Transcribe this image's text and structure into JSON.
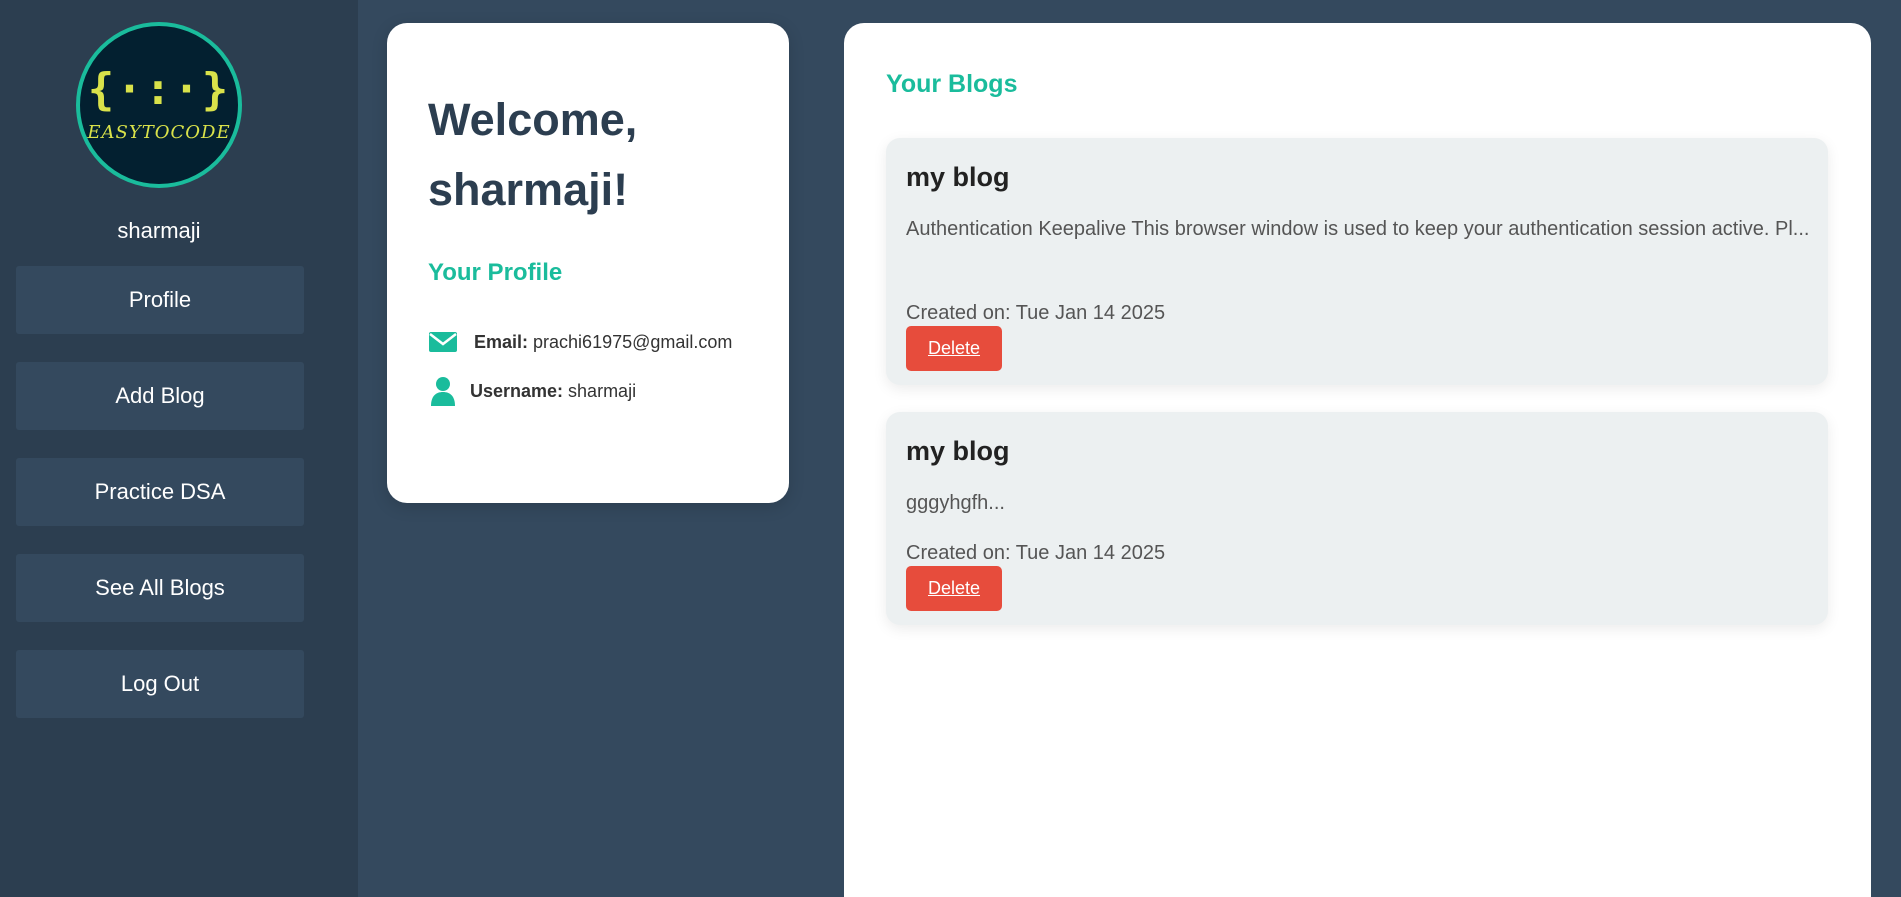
{
  "brand": {
    "logo_symbol": "{·:·}",
    "logo_text": "EASYTOCODE",
    "accent_color": "#1abc9c",
    "logo_color": "#d9e24a"
  },
  "sidebar": {
    "username": "sharmaji",
    "items": [
      {
        "label": "Profile"
      },
      {
        "label": "Add Blog"
      },
      {
        "label": "Practice DSA"
      },
      {
        "label": "See All Blogs"
      },
      {
        "label": "Log Out"
      }
    ]
  },
  "welcome": {
    "title": "Welcome, sharmaji!",
    "profile_heading": "Your Profile",
    "email_label": "Email:",
    "email_value": "prachi61975@gmail.com",
    "email_icon": "envelope-icon",
    "username_label": "Username:",
    "username_value": "sharmaji",
    "username_icon": "user-icon"
  },
  "blogs": {
    "heading": "Your Blogs",
    "items": [
      {
        "title": "my blog",
        "excerpt": "Authentication Keepalive This browser window is used to keep your authentication session active. Pl...",
        "created": "Created on: Tue Jan 14 2025",
        "delete_label": "Delete"
      },
      {
        "title": "my blog",
        "excerpt": "gggyhgfh...",
        "created": "Created on: Tue Jan 14 2025",
        "delete_label": "Delete"
      }
    ]
  },
  "colors": {
    "sidebar_bg": "#2c3e50",
    "page_bg": "#34495e",
    "delete_bg": "#e74c3c"
  }
}
